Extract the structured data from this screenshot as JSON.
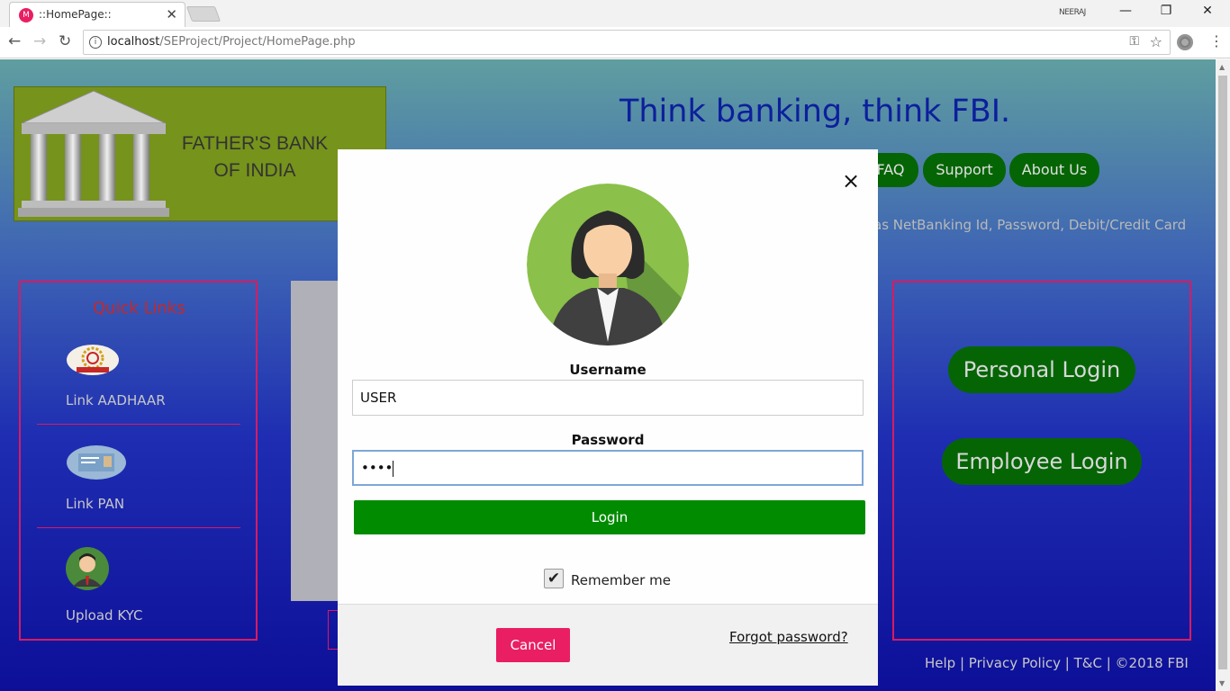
{
  "browser": {
    "tab_title": "::HomePage::",
    "tab_close": "✕",
    "favicon": "M",
    "user_name": "NEERAJ",
    "minimize": "—",
    "restore": "❐",
    "close": "✕",
    "url_host": "localhost",
    "url_path": "/SEProject/Project/HomePage.php"
  },
  "header": {
    "logo_line1": "FATHER'S BANK",
    "logo_line2": "OF INDIA",
    "tagline": "Think banking, think FBI.",
    "nav": [
      "FAQ",
      "Support",
      "About Us"
    ],
    "marquee": "as NetBanking Id, Password, Debit/Credit Card"
  },
  "quick_links": {
    "title": "Quick Links",
    "items": [
      "Link AADHAAR",
      "Link PAN",
      "Upload KYC"
    ]
  },
  "login_panel": {
    "personal": "Personal Login",
    "employee": "Employee Login"
  },
  "footer": {
    "text": "Help | Privacy Policy | T&C | ©2018 FBI"
  },
  "modal": {
    "close": "×",
    "username_label": "Username",
    "username_value": "USER",
    "password_label": "Password",
    "password_value": "••••",
    "login_button": "Login",
    "remember_label": "Remember me",
    "remember_checked": true,
    "checkmark": "✔",
    "cancel_button": "Cancel",
    "forgot_link": "Forgot password?"
  },
  "colors": {
    "accent_green": "#008b00",
    "nav_green": "#056505",
    "cancel_pink": "#e91e63",
    "border_pink": "#d81b60"
  }
}
